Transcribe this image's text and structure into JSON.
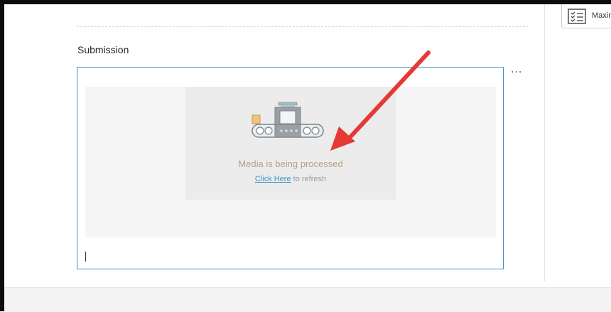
{
  "header": {
    "title": "Submission"
  },
  "editor": {
    "media": {
      "status_text": "Media is being processed",
      "refresh_link": "Click Here",
      "refresh_suffix": "to refresh"
    }
  },
  "toolbar": {
    "more_label": "..."
  },
  "sidebar": {
    "button_label": "Maxin"
  },
  "colors": {
    "accent": "#3d8ad6",
    "annotation_arrow": "#e53935",
    "status_text": "#b89f84"
  }
}
